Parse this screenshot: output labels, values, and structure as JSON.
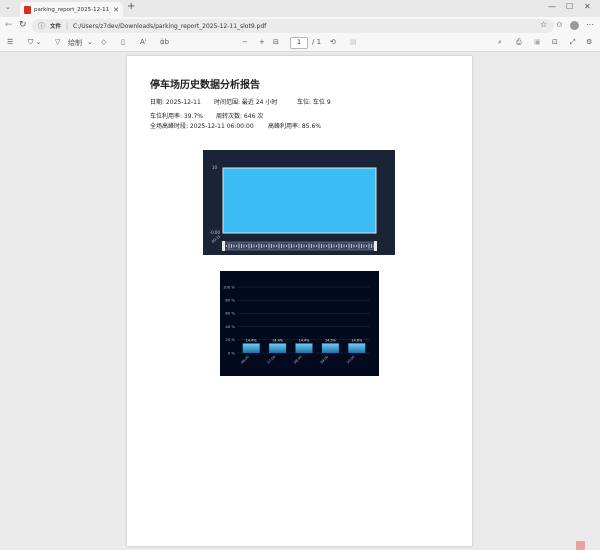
{
  "browser": {
    "tab_title": "parking_report_2025-12-11_slot9.pdf",
    "new_tab": "+",
    "url_chip": "文件",
    "url": "C:/Users/z7dev/Downloads/parking_report_2025-12-11_slot9.pdf"
  },
  "pdf_toolbar": {
    "draw_label": "绘制",
    "page_current": "1",
    "page_total": "/ 1",
    "zoom_minus": "−",
    "zoom_plus": "+"
  },
  "report": {
    "title": "停车场历史数据分析报告",
    "date": "日期: 2025-12-11",
    "time_range": "时间范围: 最近 24 小时",
    "slot": "车位: 车位 9",
    "utilization": "车位利用率: 39.7%",
    "turnover": "周转次数: 646 次",
    "peak_period": "全场高峰时段: 2025-12-11 06:00:00",
    "peak_utilization": "高峰利用率: 85.6%"
  },
  "chart_data": [
    {
      "type": "heatmap",
      "y_tick_top": "10",
      "y_tick_bottom": "-0.00",
      "x_tick_first": "09:15",
      "fill_color": "#3bbcf5"
    },
    {
      "type": "bar",
      "categories": [
        "06:00",
        "07:00",
        "08:00",
        "09:00",
        "10:00"
      ],
      "values": [
        14.4,
        14.4,
        14.4,
        14.5,
        14.6
      ],
      "value_labels": [
        "14.4%",
        "14.4%",
        "14.4%",
        "14.5%",
        "14.6%"
      ],
      "yticks": [
        "100 %",
        "80 %",
        "60 %",
        "40 %",
        "20 %",
        "0 %"
      ],
      "ylim": [
        0,
        100
      ]
    }
  ]
}
